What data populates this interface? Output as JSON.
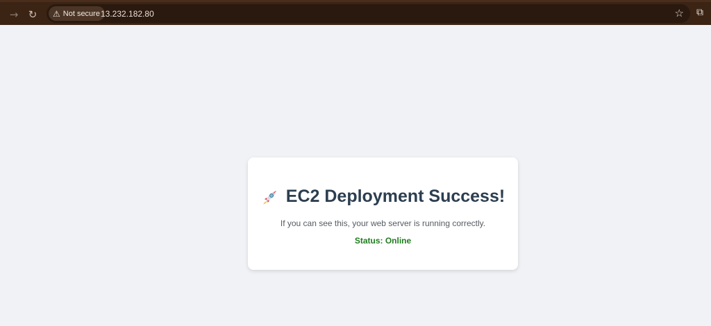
{
  "browser": {
    "security_label": "Not secure",
    "url": "13.232.182.80"
  },
  "icons": {
    "back": "arrow-right-icon",
    "reload": "reload-icon",
    "warning": "warning-icon",
    "bookmark": "star-icon",
    "extensions": "puzzle-icon",
    "heading": "rocket-icon"
  },
  "page": {
    "heading": "EC2 Deployment Success!",
    "message": "If you can see this, your web server is running correctly.",
    "status": "Status: Online"
  },
  "colors": {
    "toolbar": "#3b2414",
    "page_background": "#f0f2f5",
    "heading": "#2c3e50",
    "status": "#1e7d1e"
  }
}
